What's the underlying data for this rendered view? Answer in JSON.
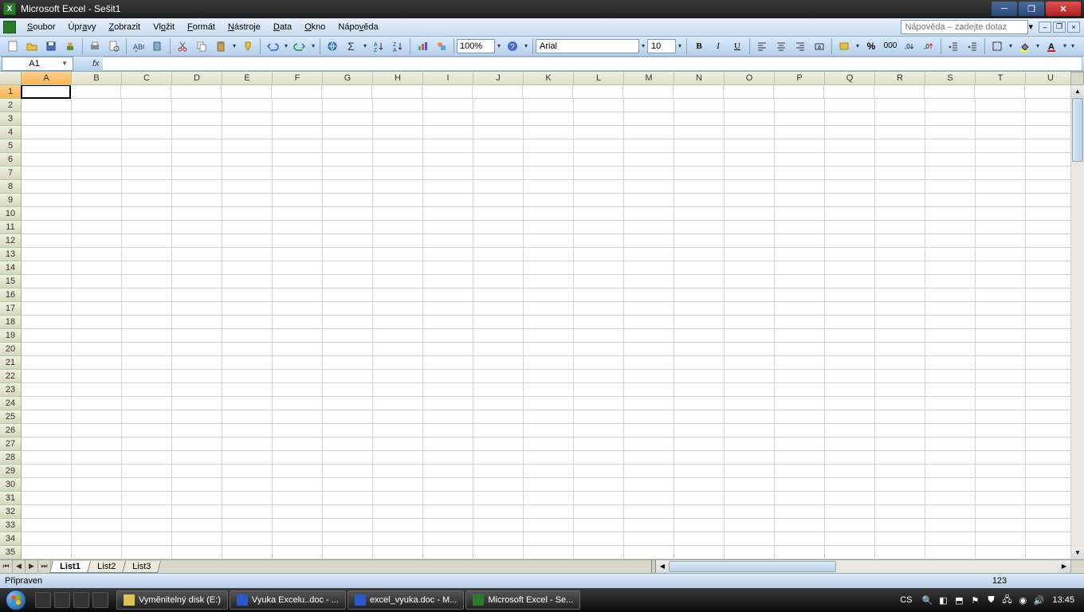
{
  "titlebar": {
    "app": "Microsoft Excel",
    "document": "Sešit1"
  },
  "menu": {
    "items": [
      "Soubor",
      "Úpravy",
      "Zobrazit",
      "Vložit",
      "Formát",
      "Nástroje",
      "Data",
      "Okno",
      "Nápověda"
    ],
    "accel_idx": [
      0,
      3,
      0,
      2,
      0,
      0,
      0,
      0,
      4
    ]
  },
  "help_placeholder": "Nápověda – zadejte dotaz",
  "toolbar": {
    "zoom": "100%",
    "font_name": "Arial",
    "font_size": "10"
  },
  "formula": {
    "name_box": "A1",
    "value": ""
  },
  "grid": {
    "columns": [
      "A",
      "B",
      "C",
      "D",
      "E",
      "F",
      "G",
      "H",
      "I",
      "J",
      "K",
      "L",
      "M",
      "N",
      "O",
      "P",
      "Q",
      "R",
      "S",
      "T",
      "U"
    ],
    "row_count": 35,
    "selected_col": 0,
    "selected_row": 0
  },
  "sheets": {
    "tabs": [
      "List1",
      "List2",
      "List3"
    ],
    "active": 0
  },
  "status": {
    "ready": "Připraven",
    "num_indicator": "123"
  },
  "taskbar": {
    "items": [
      {
        "label": "Vyměnitelný disk (E:)",
        "kind": "explorer"
      },
      {
        "label": "Vyuka Excelu..doc - ...",
        "kind": "word"
      },
      {
        "label": "excel_vyuka.doc - M...",
        "kind": "word"
      },
      {
        "label": "Microsoft Excel - Se...",
        "kind": "excel"
      }
    ],
    "lang": "CS",
    "clock": "13:45"
  }
}
